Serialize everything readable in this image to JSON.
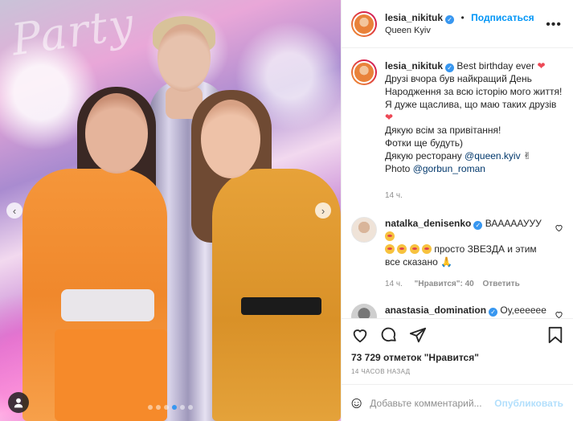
{
  "post": {
    "author": "lesia_nikituk",
    "follow_label": "Подписаться",
    "separator": "•",
    "location": "Queen Kyiv",
    "more_label": "•••"
  },
  "caption": {
    "username": "lesia_nikituk",
    "line1": "Best birthday ever",
    "line2": "Друзі вчора був найкращий День Народження за всю історію мого життя! Я дуже щаслива, що маю таких друзів",
    "line3": "Дякую всім за привітання!",
    "line4": "Фотки ще будуть)",
    "line5_prefix": "Дякую ресторану",
    "line5_link": "@queen.kyiv",
    "line6_prefix": "Photo",
    "line6_link": "@gorbun_roman",
    "time": "14 ч."
  },
  "comments": [
    {
      "username": "natalka_denisenko",
      "text_a": "ВАААААУУУ",
      "text_b": "просто ЗВЕЗДА и этим все сказано",
      "time": "14 ч.",
      "likes": "\"Нравится\": 40",
      "reply": "Ответить"
    },
    {
      "username": "anastasia_domination",
      "text_a": "Оу,ееееее"
    }
  ],
  "stats": {
    "likes": "73 729 отметок \"Нравится\"",
    "time_ago": "14 ЧАСОВ НАЗАД"
  },
  "composer": {
    "placeholder": "Добавьте комментарий...",
    "publish_label": "Опубликовать"
  },
  "media": {
    "neon_sign": "Party",
    "dot_count": 6,
    "active_dot": 3
  },
  "colors": {
    "link": "#00376b",
    "accent": "#0095f6",
    "verified": "#3897f0",
    "heart": "#ed4956",
    "muted": "#8e8e8e"
  }
}
